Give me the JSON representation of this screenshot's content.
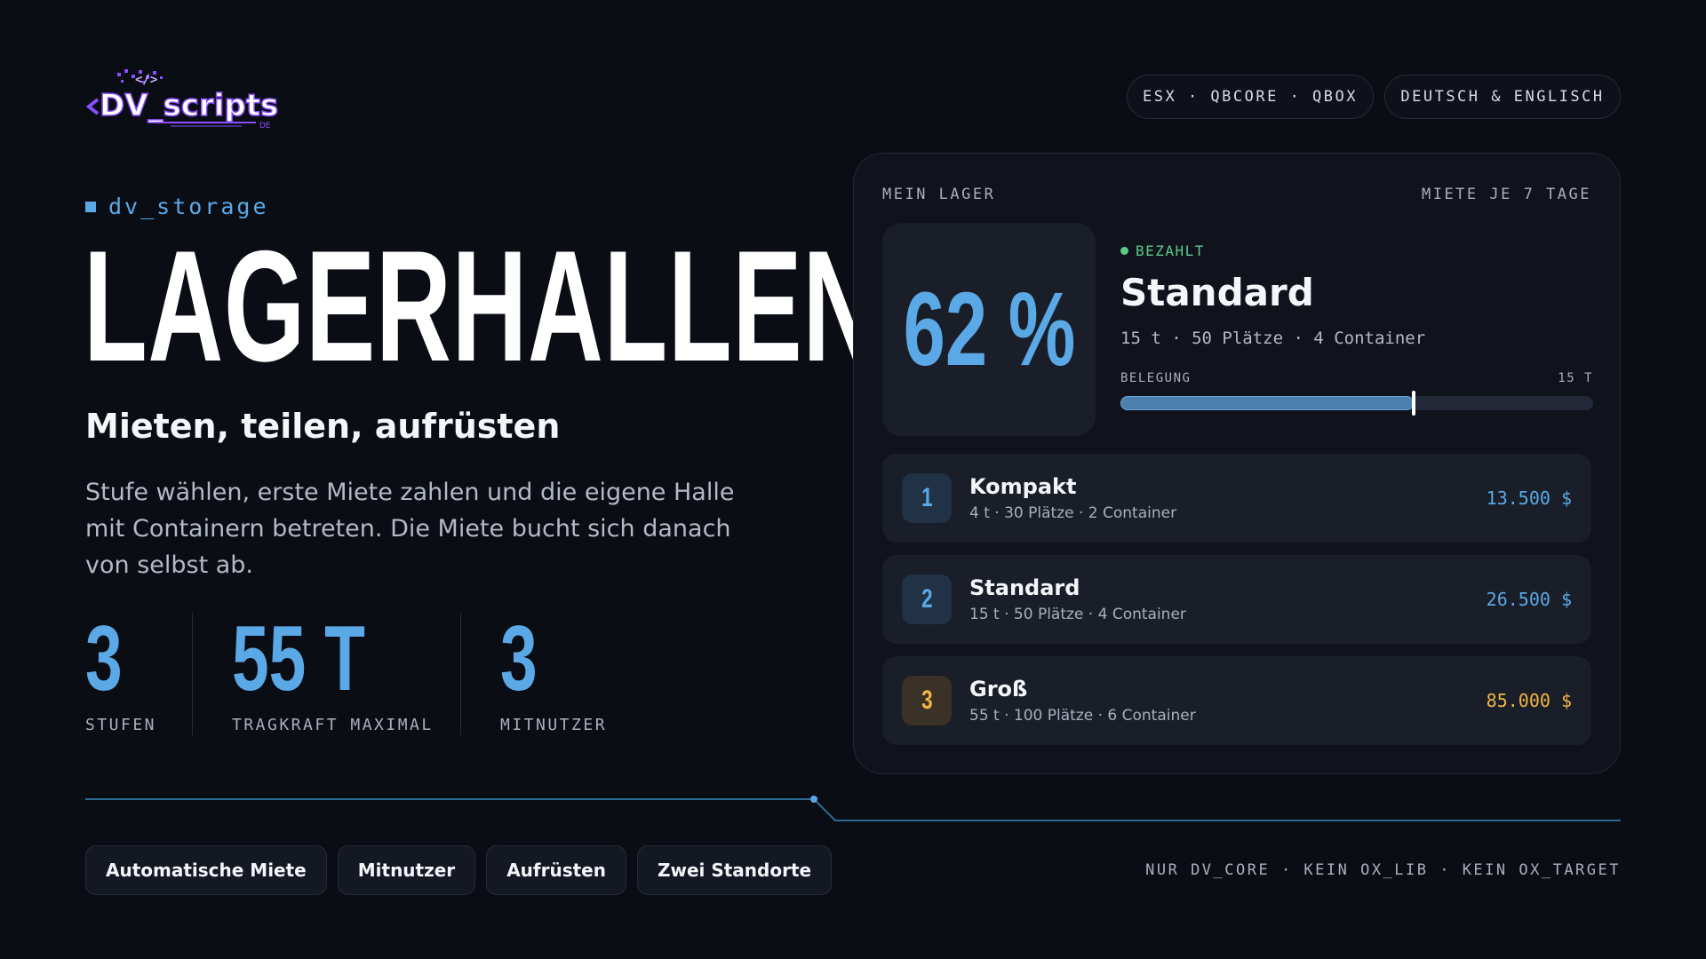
{
  "logo": {
    "text": "DV_scripts",
    "sub": "DE"
  },
  "header": {
    "frameworks": "ESX · QBCORE · QBOX",
    "languages": "DEUTSCH & ENGLISCH"
  },
  "hero": {
    "eyebrow": "dv_storage",
    "title": "LAGERHALLEN",
    "subtitle": "Mieten, teilen, aufrüsten",
    "description": "Stufe wählen, erste Miete zahlen und die eigene Halle mit Containern betreten. Die Miete bucht sich danach von selbst ab."
  },
  "stats": [
    {
      "value": "3",
      "label": "STUFEN"
    },
    {
      "value": "55 T",
      "label": "TRAGKRAFT MAXIMAL"
    },
    {
      "value": "3",
      "label": "MITNUTZER"
    }
  ],
  "panel": {
    "title": "MEIN LAGER",
    "rent_period": "MIETE JE 7 TAGE",
    "occupancy_display": "62 %",
    "occupancy_fraction": 0.62,
    "status": "BEZAHLT",
    "current_tier": "Standard",
    "current_specs": "15 t · 50 Plätze · 4 Container",
    "bar_label": "BELEGUNG",
    "bar_capacity": "15 T",
    "tiers": [
      {
        "num": "1",
        "name": "Kompakt",
        "specs": "4 t · 30 Plätze · 2 Container",
        "price": "13.500 $",
        "accent": "#5aa9e6"
      },
      {
        "num": "2",
        "name": "Standard",
        "specs": "15 t · 50 Plätze · 4 Container",
        "price": "26.500 $",
        "accent": "#5aa9e6"
      },
      {
        "num": "3",
        "name": "Groß",
        "specs": "55 t · 100 Plätze · 6 Container",
        "price": "85.000 $",
        "accent": "#f0b545"
      }
    ]
  },
  "features": [
    "Automatische Miete",
    "Mitnutzer",
    "Aufrüsten",
    "Zwei Standorte"
  ],
  "footer": {
    "note": "NUR DV_CORE · KEIN OX_LIB · KEIN OX_TARGET"
  },
  "colors": {
    "background": "#0b0d14",
    "accent": "#5aa9e6",
    "gold": "#f0b545",
    "success": "#5dc98b",
    "logo_purple": "#8a4dff"
  }
}
